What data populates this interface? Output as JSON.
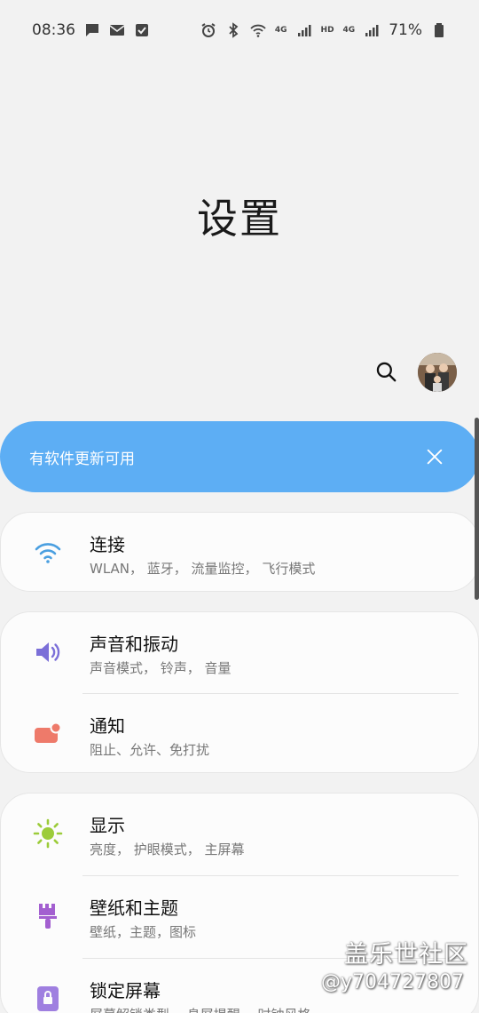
{
  "status_bar": {
    "time": "08:36",
    "battery": "71%",
    "net1": "4G",
    "hd": "HD",
    "net2": "4G",
    "left_icons": [
      "message-icon",
      "mail-icon",
      "checkbox-icon"
    ],
    "right_icons": [
      "alarm-icon",
      "bluetooth-icon",
      "wifi-icon",
      "signal-icon",
      "signal-icon",
      "battery-icon"
    ]
  },
  "header": {
    "title": "设置"
  },
  "banner": {
    "text": "有软件更新可用",
    "color": "#5daef4"
  },
  "groups": [
    {
      "items": [
        {
          "title": "连接",
          "subtitle": "WLAN， 蓝牙， 流量监控， 飞行模式",
          "icon": "wifi-icon",
          "icon_color": "#4a9fe0"
        }
      ]
    },
    {
      "items": [
        {
          "title": "声音和振动",
          "subtitle": "声音模式， 铃声， 音量",
          "icon": "speaker-icon",
          "icon_color": "#7b6fd8"
        },
        {
          "title": "通知",
          "subtitle": "阻止、允许、免打扰",
          "icon": "notification-icon",
          "icon_color": "#ee7a6a"
        }
      ]
    },
    {
      "items": [
        {
          "title": "显示",
          "subtitle": "亮度， 护眼模式， 主屏幕",
          "icon": "brightness-icon",
          "icon_color": "#9ccc3a"
        },
        {
          "title": "壁纸和主题",
          "subtitle": "壁纸，主题，图标",
          "icon": "paintbrush-icon",
          "icon_color": "#a35fd0"
        },
        {
          "title": "锁定屏幕",
          "subtitle": "屏幕解锁类型， 息屏提醒， 时钟风格",
          "icon": "lock-icon",
          "icon_color": "#9f7fe0"
        }
      ]
    }
  ],
  "watermark": {
    "line1": "盖乐世社区",
    "line2": "@y704727807"
  }
}
